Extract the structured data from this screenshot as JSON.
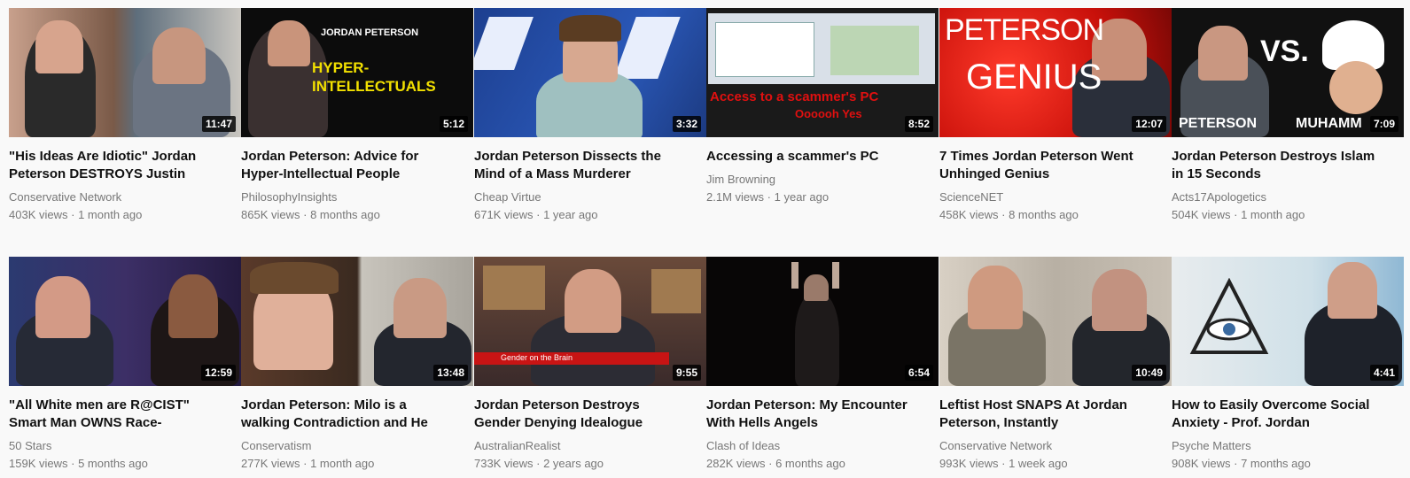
{
  "videos": [
    {
      "title": "\"His Ideas Are Idiotic\" Jordan Peterson DESTROYS Justin",
      "channel": "Conservative Network",
      "views": "403K views",
      "age": "1 month ago",
      "duration": "11:47"
    },
    {
      "title": "Jordan Peterson: Advice for Hyper-Intellectual People",
      "channel": "PhilosophyInsights",
      "views": "865K views",
      "age": "8 months ago",
      "duration": "5:12",
      "overlay": [
        "JORDAN PETERSON",
        "HYPER-",
        "INTELLECTUALS"
      ]
    },
    {
      "title": "Jordan Peterson Dissects the Mind of a Mass Murderer",
      "channel": "Cheap Virtue",
      "views": "671K views",
      "age": "1 year ago",
      "duration": "3:32"
    },
    {
      "title": "Accessing a scammer's PC",
      "channel": "Jim Browning",
      "views": "2.1M views",
      "age": "1 year ago",
      "duration": "8:52",
      "overlay": [
        "Access to a scammer's PC",
        "Oooooh Yes"
      ]
    },
    {
      "title": "7 Times Jordan Peterson Went Unhinged Genius",
      "channel": "ScienceNET",
      "views": "458K views",
      "age": "8 months ago",
      "duration": "12:07",
      "overlay": [
        "PETERSON",
        "GENIUS"
      ]
    },
    {
      "title": "Jordan Peterson Destroys Islam in 15 Seconds",
      "channel": "Acts17Apologetics",
      "views": "504K views",
      "age": "1 month ago",
      "duration": "7:09",
      "overlay": [
        "VS.",
        "PETERSON",
        "MUHAMM"
      ]
    },
    {
      "title": "\"All White men are R@CIST\" Smart Man OWNS Race-",
      "channel": "50 Stars",
      "views": "159K views",
      "age": "5 months ago",
      "duration": "12:59"
    },
    {
      "title": "Jordan Peterson: Milo is a walking Contradiction and He",
      "channel": "Conservatism",
      "views": "277K views",
      "age": "1 month ago",
      "duration": "13:48"
    },
    {
      "title": "Jordan Peterson Destroys Gender Denying Idealogue",
      "channel": "AustralianRealist",
      "views": "733K views",
      "age": "2 years ago",
      "duration": "9:55",
      "overlay": [
        "Gender on the Brain"
      ]
    },
    {
      "title": "Jordan Peterson: My Encounter With Hells Angels",
      "channel": "Clash of Ideas",
      "views": "282K views",
      "age": "6 months ago",
      "duration": "6:54"
    },
    {
      "title": "Leftist Host SNAPS At Jordan Peterson, Instantly",
      "channel": "Conservative Network",
      "views": "993K views",
      "age": "1 week ago",
      "duration": "10:49"
    },
    {
      "title": "How to Easily Overcome Social Anxiety - Prof. Jordan",
      "channel": "Psyche Matters",
      "views": "908K views",
      "age": "7 months ago",
      "duration": "4:41"
    }
  ],
  "separator": "·",
  "colors": {
    "title": "#111111",
    "meta": "#777777",
    "background": "#f9f9f9"
  }
}
